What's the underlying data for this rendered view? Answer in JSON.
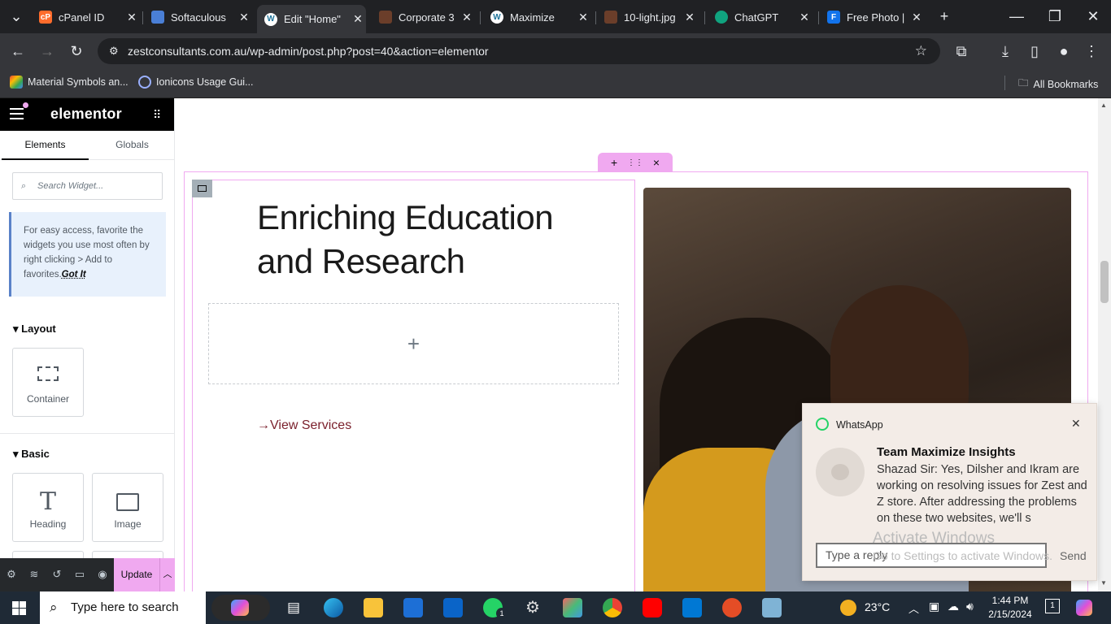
{
  "browser": {
    "tabs": [
      {
        "title": "cPanel ID",
        "icon": "cpanel-icon",
        "color": "#ff6c2c"
      },
      {
        "title": "Softaculous",
        "icon": "softaculous-icon",
        "color": "#4a7fd6"
      },
      {
        "title": "Edit \"Home\"",
        "icon": "wordpress-icon",
        "color": "#21759b",
        "active": true
      },
      {
        "title": "Corporate 3",
        "icon": "corporate-icon",
        "color": "#c47a4e"
      },
      {
        "title": "Maximize",
        "icon": "wordpress-icon",
        "color": "#21759b"
      },
      {
        "title": "10-light.jpg",
        "icon": "file-icon",
        "color": "#c47a4e"
      },
      {
        "title": "ChatGPT",
        "icon": "chatgpt-icon",
        "color": "#10a37f"
      },
      {
        "title": "Free Photo |",
        "icon": "freepik-icon",
        "color": "#1273eb"
      }
    ],
    "url": "zestconsultants.com.au/wp-admin/post.php?post=40&action=elementor",
    "bookmarks": [
      {
        "label": "Material Symbols an...",
        "icon": "google-fonts-icon"
      },
      {
        "label": "Ionicons Usage Gui...",
        "icon": "ionicons-icon"
      }
    ],
    "all_bookmarks": "All Bookmarks"
  },
  "panel": {
    "brand": "elementor",
    "tabs": [
      "Elements",
      "Globals"
    ],
    "search_placeholder": "Search Widget...",
    "tip_text": "For easy access, favorite the widgets you use most often by right clicking > Add to favorites.",
    "tip_link": "Got It",
    "layout_label": "Layout",
    "layout_widgets": [
      {
        "label": "Container",
        "icon": "container-icon"
      }
    ],
    "basic_label": "Basic",
    "basic_widgets": [
      {
        "label": "Heading",
        "icon": "heading-icon"
      },
      {
        "label": "Image",
        "icon": "image-icon"
      }
    ],
    "update_label": "Update"
  },
  "canvas": {
    "heading": "Enriching Education and Research",
    "view_services": "View Services",
    "add_icon": "+",
    "section_handle": [
      "+",
      "⋮⋮",
      "×"
    ]
  },
  "whatsapp": {
    "app": "WhatsApp",
    "group": "Team Maximize Insights",
    "message": "Shazad Sir: Yes, Dilsher and Ikram are working on resolving issues for Zest and Z store. After addressing the problems on these two websites, we'll s",
    "reply_placeholder": "Type a reply",
    "send": "Send",
    "watermark_title": "Activate Windows",
    "watermark_sub": "Go to Settings to activate Windows."
  },
  "taskbar": {
    "search": "Type here to search",
    "temperature": "23°C",
    "time": "1:44 PM",
    "date": "2/15/2024",
    "notif_count": "1",
    "whatsapp_badge": "1"
  }
}
